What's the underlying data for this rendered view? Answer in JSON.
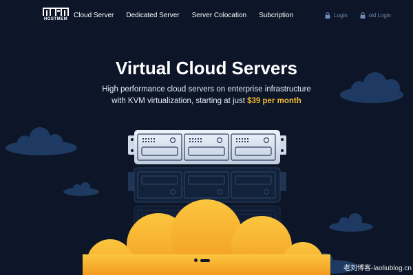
{
  "brand": {
    "logo_text": "HOSTMEM"
  },
  "nav": {
    "links": [
      {
        "label": "Cloud Server"
      },
      {
        "label": "Dedicated Server"
      },
      {
        "label": "Server Colocation"
      },
      {
        "label": "Subcription"
      }
    ],
    "login_label": "Login",
    "old_login_label": "old Login"
  },
  "hero": {
    "title": "Virtual Cloud Servers",
    "subtitle_line1": "High performance cloud servers on enterprise infrastructure",
    "subtitle_line2": "with KVM virtualization, starting at just ",
    "price": "$39 per month"
  },
  "slider": {
    "slides": 2,
    "active_index": 0
  },
  "watermark": "老刘博客-laoliublog.cn",
  "colors": {
    "background": "#0c1628",
    "accent": "#f2b833",
    "cloud_dark": "#1e3a63",
    "cloud_orange": "#f6a623"
  },
  "icons": {
    "login": "lock-icon",
    "old_login": "lock-icon"
  }
}
